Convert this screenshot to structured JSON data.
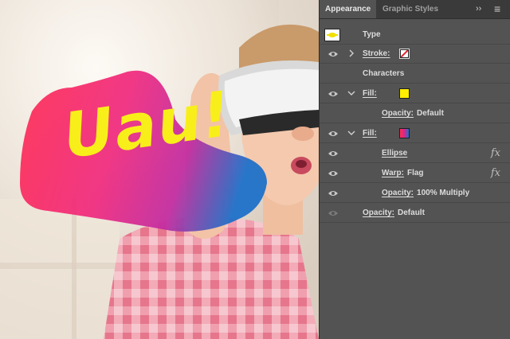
{
  "colors": {
    "panel_bg": "#535353",
    "tab_bar_bg": "#3a3a3a",
    "headline_text": "#f8ef1a",
    "shape_gradient": [
      "#ff1f4f",
      "#e0208a",
      "#1070c8"
    ],
    "fill1_swatch": "#ffee00"
  },
  "artwork": {
    "headline": "Uau!"
  },
  "panel": {
    "tabs": [
      {
        "label": "Appearance",
        "active": true
      },
      {
        "label": "Graphic Styles",
        "active": false
      }
    ],
    "overflow_icon": "double-chevron-right-icon",
    "menu_icon": "hamburger-menu-icon",
    "rows": {
      "type": {
        "label": "Type",
        "icon": "type-thumbnail-icon"
      },
      "stroke": {
        "label": "Stroke:",
        "icon": "none-swatch-icon"
      },
      "characters": {
        "label": "Characters"
      },
      "fill1": {
        "label": "Fill:",
        "swatch_icon": "yellow-swatch-icon"
      },
      "opacity1": {
        "label": "Opacity:",
        "value": "Default"
      },
      "fill2": {
        "label": "Fill:",
        "swatch_icon": "gradient-swatch-icon"
      },
      "ellipse": {
        "label": "Ellipse",
        "icon": "fx-icon"
      },
      "warp": {
        "label": "Warp:",
        "value": "Flag",
        "icon": "fx-icon"
      },
      "opacity2": {
        "label": "Opacity:",
        "value": "100% Multiply"
      },
      "opacity3": {
        "label": "Opacity:",
        "value": "Default"
      }
    },
    "fx_label": "fx",
    "overflow_label": "››",
    "menu_label": "≡"
  }
}
